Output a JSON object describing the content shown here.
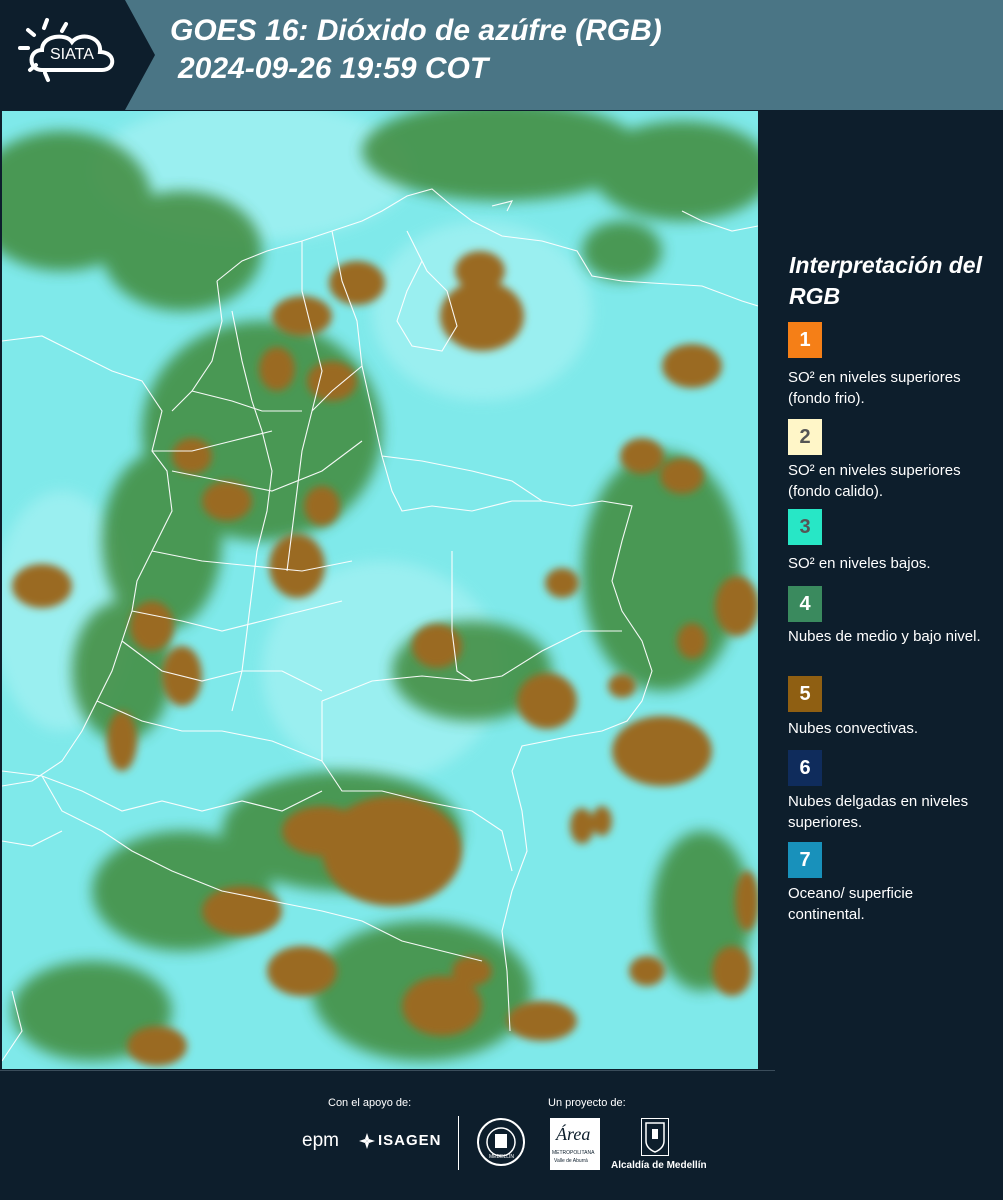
{
  "header": {
    "logo_text": "SIATA",
    "title_line1": "GOES 16: Dióxido de azúfre (RGB)",
    "title_line2": "2024-09-26 19:59 COT"
  },
  "map": {
    "product": "GOES 16 SO2 RGB composite",
    "colors": {
      "clear_surface": "#7fe9ea",
      "convective_clouds": "#9a6a22",
      "mid_low_clouds": "#3f8a3a",
      "border_lines": "#ffffff"
    }
  },
  "legend": {
    "title": "Interpretación del RGB",
    "items": [
      {
        "number": "1",
        "color": "#f57f17",
        "text": "SO² en niveles superiores (fondo frio)."
      },
      {
        "number": "2",
        "color": "#fff6c8",
        "text": "SO² en niveles superiores (fondo calido)."
      },
      {
        "number": "3",
        "color": "#27e7c6",
        "text": "SO² en niveles bajos."
      },
      {
        "number": "4",
        "color": "#3a8a5e",
        "text": "Nubes de medio y bajo nivel."
      },
      {
        "number": "5",
        "color": "#8f5f12",
        "text": "Nubes convectivas."
      },
      {
        "number": "6",
        "color": "#0f2c5c",
        "text": "Nubes delgadas en niveles superiores."
      },
      {
        "number": "7",
        "color": "#1891bb",
        "text": "Oceano/ superficie continental."
      }
    ]
  },
  "footer": {
    "support_label": "Con el apoyo de:",
    "project_label": "Un proyecto de:",
    "sponsor_epm": "epm",
    "sponsor_isagen": "ISAGEN",
    "partner_area": "Área",
    "partner_area_sub1": "METROPOLITANA",
    "partner_area_sub2": "Valle de Aburrá",
    "partner_alcaldia": "Alcaldía de Medellín",
    "partner_seal": "MEDELLÍN"
  }
}
